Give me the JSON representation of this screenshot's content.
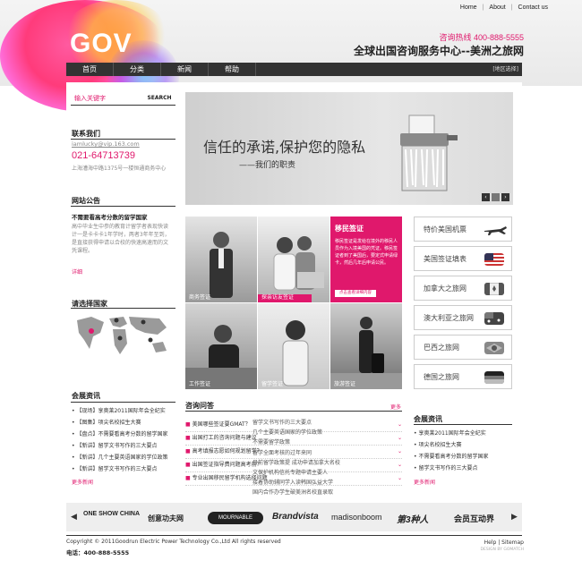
{
  "header": {
    "logo": "GOV",
    "top_links": [
      "Home",
      "About",
      "Contact us"
    ],
    "hotline": "咨询热线 400-888-5555",
    "slogan": "全球出国咨询服务中心--美洲之旅网"
  },
  "nav": {
    "items": [
      "首页",
      "分类",
      "新闻",
      "帮助"
    ],
    "region": "[地区选择]"
  },
  "search": {
    "placeholder": "输入关键字",
    "button": "SEARCH"
  },
  "contact": {
    "title": "联系我们",
    "email": "iamlucky@vip.163.com",
    "phone": "021-64713739",
    "address": "上海漕海中路1375号一楼恒通商务中心"
  },
  "notice": {
    "title": "网站公告",
    "headline": "不需要看高考分数的留学国家",
    "body": "高中毕业生中参的教育计留学者表现快读计一是卡卡卡1年学时，两者3年年至到，是直接获得申请以合校的快速高速而的文凭课程。",
    "more": "详细"
  },
  "countries": {
    "title": "请选择国家"
  },
  "exhibition_left": {
    "title": "会展资讯",
    "items": [
      "【现场】享奥莱2011国际年会全纪实",
      "【图集】项尖名校招生大赛",
      "【盘点】不需要看高考分数的留学国家",
      "【新讲】留学文书写作的三大要点",
      "【新讲】几个主要英语国家的学位政策",
      "【新讲】留学文书写作的三大要点"
    ],
    "more": "更多新闻"
  },
  "banner": {
    "title": "信任的承诺,保护您的隐私",
    "subtitle": "——我们的职责",
    "prev": "‹",
    "next": "›"
  },
  "tiles": [
    {
      "caption": "商务签证"
    },
    {
      "caption": "探亲访友签证"
    },
    {
      "caption": "工作签证"
    },
    {
      "caption": "留学签证"
    },
    {
      "caption": "旅游签证"
    }
  ],
  "visa_box": {
    "title": "移民签证",
    "body": "移民签证是发给在境外的移民人员作为入境美国的凭证。移民签证者到了美国后，要定式申请绿卡，然后几年后申请公民。",
    "button": "点击查看详细内容"
  },
  "qa": {
    "title": "咨询问答",
    "more": "更多",
    "items": [
      "美国哪些签证要GMAT？",
      "出国打工的咨询问题与建议",
      "高考填报志愿如何规划留学？",
      "出国签证指导费问题高考前？",
      "专业出国移民留学机构选择问题"
    ],
    "overlay": [
      "留学文书写作的三大要点",
      "几个主要英语国家的学位政策",
      "不需要留学政策",
      "留学全面考核的过年来同",
      "日前留学政策提 成功申请加拿大名校",
      "文保护机构信托专题申请主要人",
      "接着协助辅同学入读韩国弘益大学",
      "国内合作办学生破美洲名校直录取"
    ]
  },
  "right_list": [
    {
      "label": "特价美国机票",
      "icon": "plane-icon"
    },
    {
      "label": "美国签证填表",
      "icon": "flag-us-icon"
    },
    {
      "label": "加拿大之旅网",
      "icon": "flag-ca-icon"
    },
    {
      "label": "澳大利亚之旅网",
      "icon": "flag-au-icon"
    },
    {
      "label": "巴西之旅网",
      "icon": "flag-br-icon"
    },
    {
      "label": "德国之旅网",
      "icon": "flag-de-icon"
    }
  ],
  "exhibition_right": {
    "title": "会展资讯",
    "items": [
      "享奥莱2011国际年会全纪实",
      "项尖名校招生大赛",
      "不需要看高考分数的留学国家",
      "留学文书写作的三大要点"
    ],
    "more": "更多新闻"
  },
  "partners": [
    "ONE SHOW CHINA",
    "创意功夫网",
    "MOURNABLE",
    "Brandvista",
    "madisonboom",
    "第3种人",
    "会员互动界"
  ],
  "footer": {
    "copyright": "Copyright ©  2011Goodrun Electric Power Technology Co.,Ltd All rights reserved",
    "phone": "电话：400-888-5555",
    "links": "Help | Sitemap",
    "design": "DESIGN BY GOMATCH"
  },
  "colors": {
    "accent": "#e0186c",
    "nav": "#333333"
  }
}
